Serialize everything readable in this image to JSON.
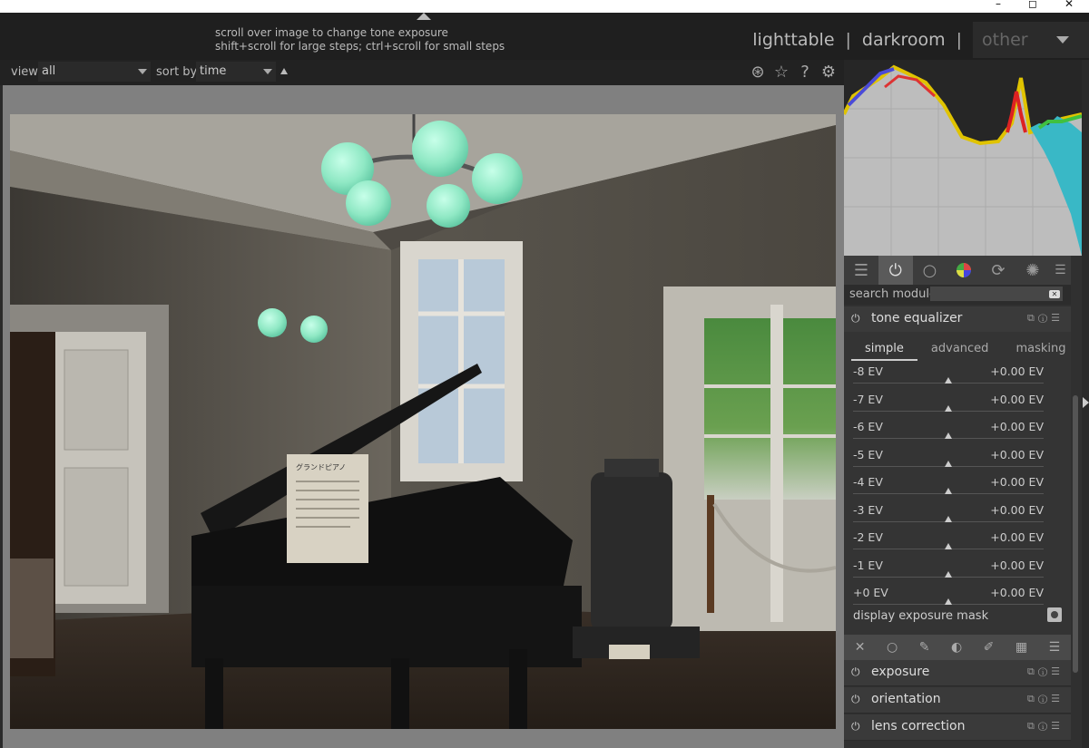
{
  "window": {
    "controls": [
      "–",
      "◻",
      "✕"
    ]
  },
  "header": {
    "hint_line1": "scroll over image to change tone exposure",
    "hint_line2": "shift+scroll for large steps; ctrl+scroll for small steps",
    "views": {
      "lighttable": "lighttable",
      "separator": "|",
      "darkroom": "darkroom",
      "other": "other"
    }
  },
  "filterbar": {
    "view_label": "view",
    "view_value": "all",
    "sort_label": "sort by",
    "sort_value": "time"
  },
  "icons": {
    "filter_icons": [
      "color-labels-icon",
      "star-icon",
      "help-icon",
      "gear-icon"
    ],
    "module_tabs": [
      "quick-access-icon",
      "power-icon",
      "base-icon",
      "color-icon",
      "correct-icon",
      "effect-icon"
    ]
  },
  "module_panel": {
    "search_label": "search module",
    "search_value": ""
  },
  "tone_equalizer": {
    "name": "tone equalizer",
    "tabs": [
      "simple",
      "advanced",
      "masking"
    ],
    "bands": [
      {
        "label": "-8 EV",
        "value": "+0.00 EV"
      },
      {
        "label": "-7 EV",
        "value": "+0.00 EV"
      },
      {
        "label": "-6 EV",
        "value": "+0.00 EV"
      },
      {
        "label": "-5 EV",
        "value": "+0.00 EV"
      },
      {
        "label": "-4 EV",
        "value": "+0.00 EV"
      },
      {
        "label": "-3 EV",
        "value": "+0.00 EV"
      },
      {
        "label": "-2 EV",
        "value": "+0.00 EV"
      },
      {
        "label": "-1 EV",
        "value": "+0.00 EV"
      },
      {
        "label": "+0 EV",
        "value": "+0.00 EV"
      }
    ],
    "display_mask_label": "display exposure mask"
  },
  "modules": [
    {
      "name": "exposure"
    },
    {
      "name": "orientation"
    },
    {
      "name": "lens correction"
    }
  ],
  "photo": {
    "sign_title": "グランドピアノ"
  },
  "colors": {
    "accent": "#cccccc",
    "panel": "#303030",
    "canvas": "#808080"
  }
}
